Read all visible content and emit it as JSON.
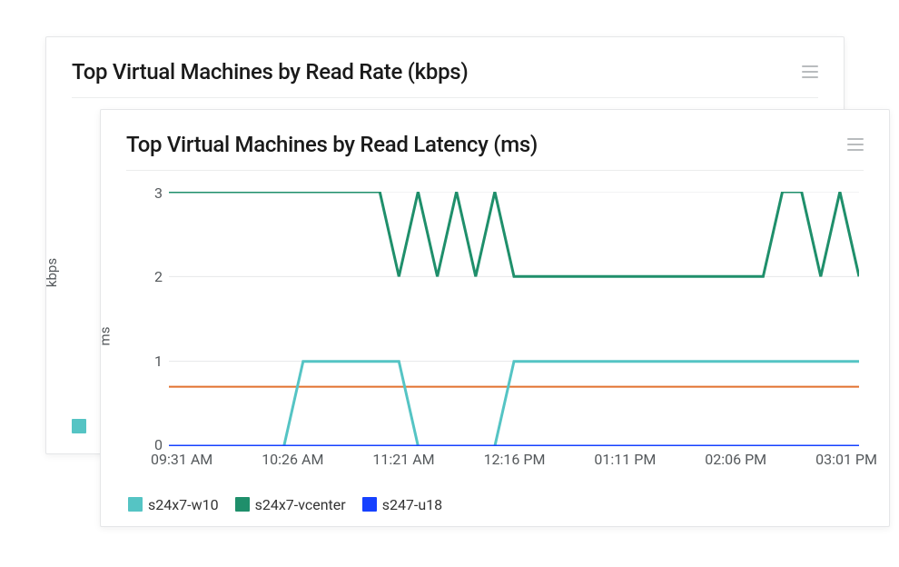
{
  "back_card": {
    "title": "Top Virtual Machines by Read Rate (kbps)",
    "ylabel": "kbps",
    "legend_swatch_color": "#55c4c4"
  },
  "front_card": {
    "title": "Top Virtual Machines by Read Latency (ms)",
    "ylabel": "ms",
    "xticks": [
      "09:31 AM",
      "10:26 AM",
      "11:21 AM",
      "12:16 PM",
      "01:11 PM",
      "02:06 PM",
      "03:01 PM"
    ],
    "yticks": [
      "3",
      "2",
      "1",
      "0"
    ],
    "legend": [
      {
        "name": "s24x7-w10",
        "color": "#55c4c4"
      },
      {
        "name": "s24x7-vcenter",
        "color": "#1f8f6b"
      },
      {
        "name": "s247-u18",
        "color": "#1641ff"
      }
    ]
  },
  "colors": {
    "threshold": "#e2722f",
    "grid": "#e6e7e9",
    "axis": "#b7b9bb"
  },
  "chart_data": {
    "type": "line",
    "title": "Top Virtual Machines by Read Latency (ms)",
    "xlabel": "",
    "ylabel": "ms",
    "ylim": [
      0,
      3
    ],
    "x_categories": [
      "09:31 AM",
      "10:26 AM",
      "11:21 AM",
      "12:16 PM",
      "01:11 PM",
      "02:06 PM",
      "03:01 PM"
    ],
    "n_points": 37,
    "series": [
      {
        "name": "s24x7-vcenter",
        "color": "#1f8f6b",
        "values": [
          3,
          3,
          3,
          3,
          3,
          3,
          3,
          3,
          3,
          3,
          3,
          3,
          2,
          3,
          2,
          3,
          2,
          3,
          2,
          2,
          2,
          2,
          2,
          2,
          2,
          2,
          2,
          2,
          2,
          2,
          2,
          2,
          3,
          3,
          2,
          3,
          2
        ]
      },
      {
        "name": "s24x7-w10",
        "color": "#55c4c4",
        "values": [
          0,
          0,
          0,
          0,
          0,
          0,
          0,
          1,
          1,
          1,
          1,
          1,
          1,
          0,
          0,
          0,
          0,
          0,
          1,
          1,
          1,
          1,
          1,
          1,
          1,
          1,
          1,
          1,
          1,
          1,
          1,
          1,
          1,
          1,
          1,
          1,
          1
        ]
      },
      {
        "name": "s247-u18",
        "color": "#1641ff",
        "values": [
          0,
          0,
          0,
          0,
          0,
          0,
          0,
          0,
          0,
          0,
          0,
          0,
          0,
          0,
          0,
          0,
          0,
          0,
          0,
          0,
          0,
          0,
          0,
          0,
          0,
          0,
          0,
          0,
          0,
          0,
          0,
          0,
          0,
          0,
          0,
          0,
          0
        ]
      }
    ],
    "threshold": {
      "value": 0.7,
      "color": "#e2722f"
    }
  }
}
